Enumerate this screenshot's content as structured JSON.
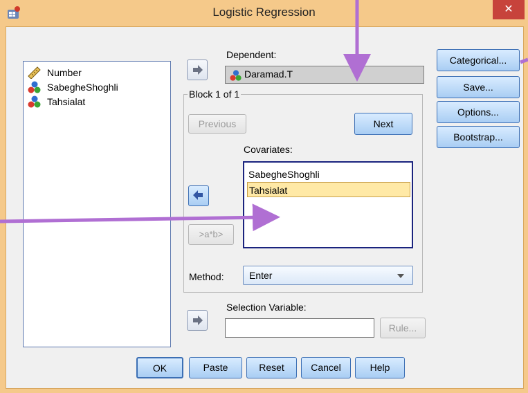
{
  "window": {
    "title": "Logistic Regression",
    "close_glyph": "✕",
    "frame_color": "#f5c98a",
    "client_color": "#f0f0f0"
  },
  "variables": [
    {
      "name": "Number",
      "icon": "ruler-icon"
    },
    {
      "name": "SabegheShoghli",
      "icon": "nominal-icon"
    },
    {
      "name": "Tahsialat",
      "icon": "nominal-icon"
    }
  ],
  "dependent": {
    "label": "Dependent:",
    "value": "Daramad.T"
  },
  "block": {
    "title": "Block 1 of 1",
    "previous_label": "Previous",
    "next_label": "Next",
    "interaction_label": ">a*b>"
  },
  "covariates": {
    "label": "Covariates:",
    "items": [
      "SabegheShoghli",
      "Tahsialat"
    ],
    "selected_index": 1
  },
  "method": {
    "label": "Method:",
    "value": "Enter"
  },
  "selection_variable": {
    "label": "Selection Variable:",
    "value": "",
    "rule_label": "Rule..."
  },
  "side_buttons": [
    "Categorical...",
    "Save...",
    "Options...",
    "Bootstrap..."
  ],
  "bottom_buttons": [
    "OK",
    "Paste",
    "Reset",
    "Cancel",
    "Help"
  ],
  "annotation_color": "#b06fd3",
  "selection_color": "#ffe9a6"
}
